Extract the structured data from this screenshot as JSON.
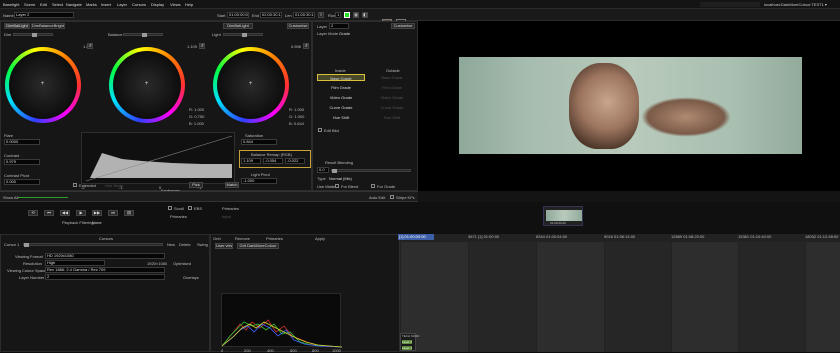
{
  "menubar": {
    "items": [
      "Baselight",
      "Scene",
      "Edit",
      "Select",
      "Navigate",
      "Marks",
      "Insert",
      "Layer",
      "Cursors",
      "Display",
      "Views",
      "Help"
    ],
    "right_text": "localhost:DarkMoreColour:TEST1 ▾"
  },
  "toolbar": {
    "name_label": "Name",
    "name_value": "Layer 2",
    "start_label": "Start",
    "start_value": "01:00:00:00",
    "end_label": "End",
    "end_value": "02:00:30:11",
    "len_label": "Len",
    "len_value": "01:00:30:12",
    "row_label": "Row",
    "row_value": "1"
  },
  "grade_panel": {
    "tabs": [
      "DimBalLight",
      "DimBalanceBright"
    ],
    "mode_left": "DimBalLight",
    "customise": "Customise",
    "wheels": [
      {
        "name": "Dim",
        "value": "1.000",
        "r": "",
        "g": "",
        "b": ""
      },
      {
        "name": "Balance",
        "value": "1.109",
        "r": "1.000",
        "g": "0.750",
        "b": "1.000"
      },
      {
        "name": "Light",
        "value": "0.596",
        "r": "1.000",
        "g": "1.000",
        "b": "0.644"
      }
    ],
    "flare": {
      "label": "Flare",
      "value": "0.0000"
    },
    "contrast": {
      "label": "Contrast",
      "value": "0.979"
    },
    "contrast_pivot": {
      "label": "Contrast Pivot",
      "value": "0.000"
    },
    "saturation": {
      "label": "Saturation",
      "value": "0.844"
    },
    "balance_remap": {
      "label": "Balance Remap (RGB)",
      "r": "1.109",
      "g": "-0.054",
      "b": "-0.022"
    },
    "light_pivot": {
      "label": "Light Pivot",
      "value": "-1.000"
    },
    "extended": "Extended",
    "hue_mode": "Hue Mode",
    "pick": "Pick",
    "match": "Match",
    "keyframes": "Keyframes",
    "curve_ticks": [
      "-2",
      "-1",
      "0",
      "+1"
    ]
  },
  "layer_panel": {
    "layer_label": "Layer",
    "layer_value": "2",
    "layer_mode_label": "Layer Mode",
    "layer_mode_value": "Grade",
    "customise": "Customise",
    "inside": "Inside",
    "outside": "Outside",
    "grades": [
      {
        "inside": "Base Grade",
        "outside": "Base Grade"
      },
      {
        "inside": "Film Grade",
        "outside": "Film Grade"
      },
      {
        "inside": "Video Grade",
        "outside": "Video Grade"
      },
      {
        "inside": "Curve Grade",
        "outside": "Curve Grade"
      },
      {
        "inside": "Hue Shift",
        "outside": "Hue Shift"
      }
    ],
    "edit_bkd": "Edit Bkd",
    "result_blending": "Result Blending",
    "blend_value": "0.0",
    "type_label": "Type",
    "type_value": "Normal (Mix)",
    "use_matte": "Use Matte",
    "for_blend": "For Blend",
    "for_grade": "For Grade"
  },
  "strip": {
    "show_all": "Show All",
    "auto_edit": "Auto Edit",
    "stripe_kf": "Stripe KFs"
  },
  "transport": {
    "playback_label": "Playback Filtering",
    "playback_value": "None",
    "scroll": "Scroll",
    "ebs": "EBS",
    "primaries": "Primaries",
    "ebs_value": "Primaries",
    "input": "Input"
  },
  "thumbnail": {
    "timecode": "01:00:00:00"
  },
  "cursors_panel": {
    "title": "Cursors",
    "cursor_label": "Cursor 1",
    "new": "New",
    "delete": "Delete",
    "swing": "Swing",
    "viewing_format_label": "Viewing Format",
    "viewing_format_value": "HD 1920x1080",
    "resolution_label": "Resolution",
    "resolution_value": "High",
    "resolution_size": "1920×1080",
    "optimised": "Optimised",
    "viewing_cs_label": "Viewing Colour Space",
    "viewing_cs_value": "Rec 1886: 2.4 Gamma / Rec 709",
    "layer_number_label": "Layer Number",
    "layer_number_value": "2",
    "overlays": "Overlays"
  },
  "scope_panel": {
    "user_view": "User view",
    "view_value": "Grit DarkMoreColour",
    "tabs": [
      "Grid",
      "Remove",
      "Primaries",
      "Apply"
    ],
    "x_ticks": [
      "0",
      "200",
      "400",
      "600",
      "800",
      "1000"
    ]
  },
  "timeline": {
    "cells": [
      {
        "tc": "[1] 01:00:00:00"
      },
      {
        "tc": "3671 [1] 01:00:00"
      },
      {
        "tc": "6344 01:00:04:00"
      },
      {
        "tc": "9016 01:06:14:00"
      },
      {
        "tc": "12689 01:08:20:00"
      },
      {
        "tc": "15361 01:10:40:00"
      },
      {
        "tc": "18032 01:12:48:00"
      }
    ],
    "track_labels": [
      "TECH MASK",
      "Layer 2",
      "Layer 1"
    ]
  }
}
